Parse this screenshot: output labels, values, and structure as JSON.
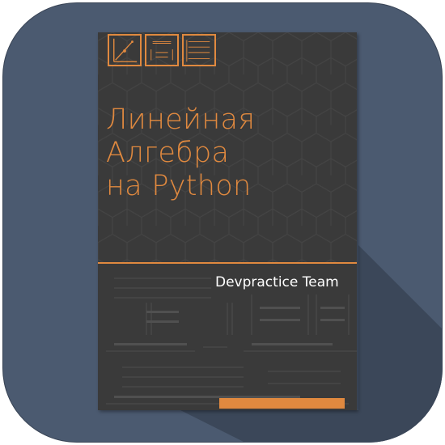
{
  "book": {
    "title_lines": [
      "Линейная",
      "Алгебра",
      "на Python"
    ],
    "author": "Devpractice Team"
  },
  "colors": {
    "icon_background": "#4b5a70",
    "book_cover": "#3a3a3a",
    "accent": "#e0893f",
    "author_text": "#ffffff"
  },
  "icons": [
    "vector-plot-icon",
    "matrix-formula-icon",
    "equation-system-icon"
  ]
}
